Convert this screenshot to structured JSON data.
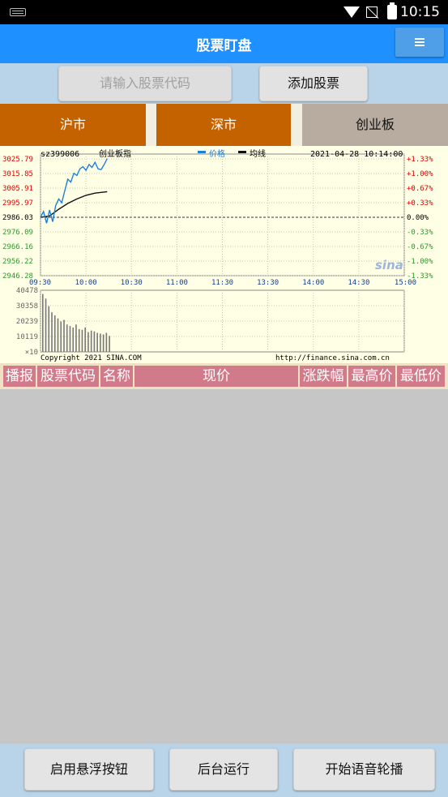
{
  "status_bar": {
    "time": "10:15"
  },
  "app": {
    "title": "股票盯盘"
  },
  "search": {
    "placeholder": "请输入股票代码",
    "add_label": "添加股票"
  },
  "tabs": [
    {
      "label": "沪市"
    },
    {
      "label": "深市"
    },
    {
      "label": "创业板"
    }
  ],
  "chart": {
    "code": "sz399006",
    "name": "创业板指",
    "legend_price": "价格",
    "legend_avg": "均线",
    "datetime": "2021-04-28 10:14:00",
    "y_left_ticks": [
      "3025.79",
      "3015.85",
      "3005.91",
      "2995.97",
      "2986.03",
      "2976.09",
      "2966.16",
      "2956.22",
      "2946.28"
    ],
    "y_right_ticks": [
      "+1.33%",
      "+1.00%",
      "+0.67%",
      "+0.33%",
      "0.00%",
      "-0.33%",
      "-0.67%",
      "-1.00%",
      "-1.33%"
    ],
    "x_ticks": [
      "09:30",
      "10:00",
      "10:30",
      "11:00",
      "11:30",
      "13:30",
      "14:00",
      "14:30",
      "15:00"
    ],
    "vol_ticks": [
      "40478",
      "30358",
      "20239",
      "10119",
      "×10"
    ],
    "copyright": "Copyright 2021 SINA.COM",
    "source_url": "http://finance.sina.com.cn",
    "watermark": "sina",
    "colors": {
      "price": "#1e7fd8",
      "avg": "#111111",
      "up": "#e00000",
      "down": "#2a9a2a",
      "flat": "#000000"
    }
  },
  "chart_data": {
    "type": "line",
    "x_range": [
      "09:30",
      "15:00"
    ],
    "ylim": [
      2946.28,
      3025.79
    ],
    "series": [
      {
        "name": "价格",
        "x": [
          "09:30",
          "09:32",
          "09:34",
          "09:36",
          "09:38",
          "09:40",
          "09:42",
          "09:44",
          "09:46",
          "09:48",
          "09:50",
          "09:52",
          "09:54",
          "09:56",
          "09:58",
          "10:00",
          "10:02",
          "10:04",
          "10:06",
          "10:08",
          "10:10",
          "10:12",
          "10:14"
        ],
        "values": [
          2986.0,
          2990.0,
          2982.0,
          2991.0,
          2983.0,
          2994.0,
          2998.5,
          2996.0,
          3004.0,
          3012.0,
          3010.0,
          3016.0,
          3014.5,
          3019.0,
          3020.5,
          3018.0,
          3022.0,
          3020.0,
          3023.5,
          3019.0,
          3018.5,
          3022.0,
          3026.0
        ]
      },
      {
        "name": "均线",
        "x": [
          "09:30",
          "09:36",
          "09:42",
          "09:48",
          "09:54",
          "10:00",
          "10:06",
          "10:14"
        ],
        "values": [
          2986.0,
          2987.0,
          2991.5,
          2995.5,
          2998.5,
          3001.0,
          3002.5,
          3003.5
        ]
      }
    ],
    "volume": {
      "x": [
        "09:30",
        "09:32",
        "09:34",
        "09:36",
        "09:38",
        "09:40",
        "09:42",
        "09:44",
        "09:46",
        "09:48",
        "09:50",
        "09:52",
        "09:54",
        "09:56",
        "09:58",
        "10:00",
        "10:02",
        "10:04",
        "10:06",
        "10:08",
        "10:10",
        "10:12",
        "10:14"
      ],
      "values": [
        38000,
        35000,
        30000,
        26000,
        24000,
        22000,
        20000,
        21000,
        18000,
        17000,
        16000,
        18000,
        15000,
        14500,
        16000,
        13000,
        14000,
        13500,
        12500,
        12000,
        11500,
        12500,
        10500
      ],
      "ylim": [
        0,
        40478
      ]
    },
    "grid": true
  },
  "table": {
    "columns": [
      "播报",
      "股票代码",
      "名称",
      "现价",
      "涨跌幅",
      "最高价",
      "最低价"
    ]
  },
  "bottom": {
    "float_btn": "启用悬浮按钮",
    "bg_btn": "后台运行",
    "voice_btn": "开始语音轮播"
  }
}
